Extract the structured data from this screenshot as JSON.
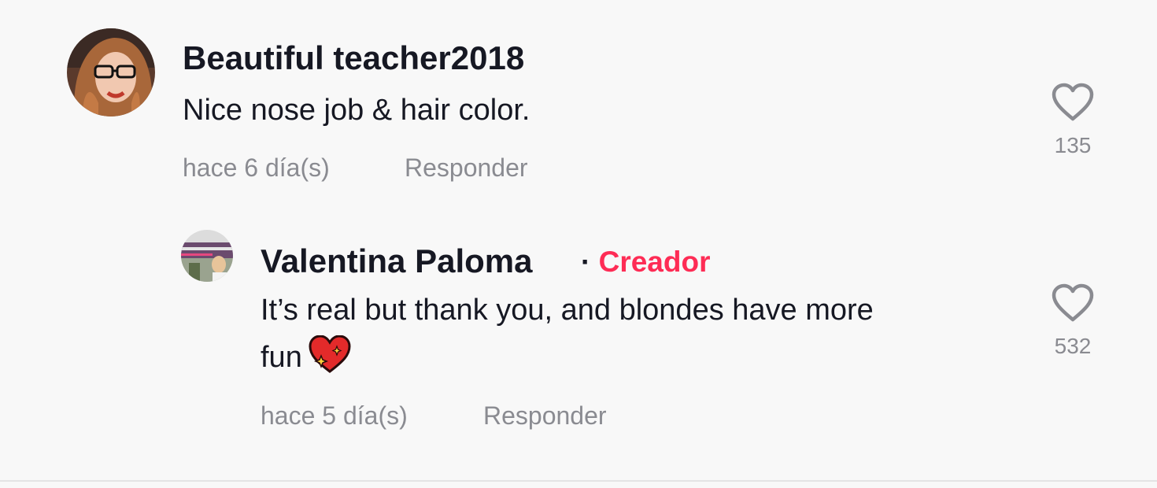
{
  "comments": [
    {
      "username": "Beautiful teacher2018",
      "text": "Nice nose job & hair color.",
      "time": "hace 6 día(s)",
      "reply_label": "Responder",
      "likes": "135"
    }
  ],
  "replies": [
    {
      "username": "Valentina Paloma",
      "separator": "·",
      "badge": "Creador",
      "text_line1": "It’s real but thank you, and blondes have more",
      "text_line2": "fun",
      "time": "hace 5 día(s)",
      "reply_label": "Responder",
      "likes": "532"
    }
  ],
  "colors": {
    "creator_badge": "#fe2c55",
    "meta_text": "#8a8b91",
    "background": "#f8f8f8"
  },
  "icons": [
    "heart-outline-icon",
    "sparkling-heart-emoji"
  ]
}
